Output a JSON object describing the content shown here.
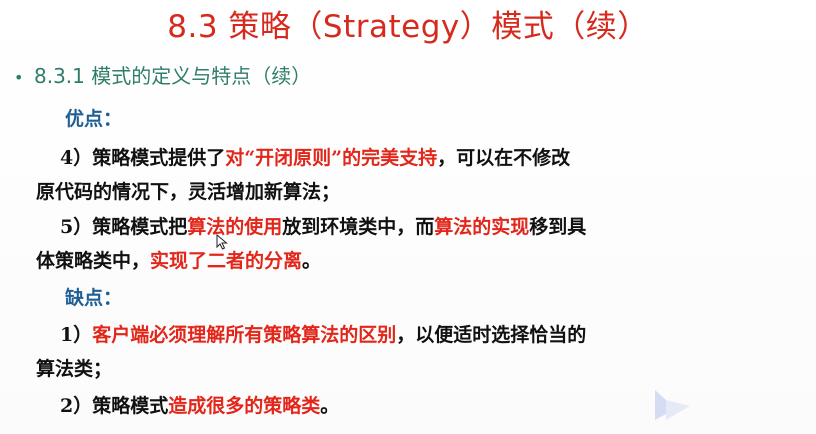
{
  "slide": {
    "title": "8.3 策略（Strategy）模式（续）",
    "section": {
      "bullet": "•",
      "text": "8.3.1 模式的定义与特点（续）"
    },
    "advantages": {
      "label": "优点：",
      "items": [
        {
          "line1": [
            {
              "text": "4）策略模式提供了",
              "emph": false
            },
            {
              "text": "对“开闭原则”的完美支持",
              "emph": true
            },
            {
              "text": "，可以在不修改",
              "emph": false
            }
          ],
          "line2": [
            {
              "text": "原代码的情况下，灵活增加新算法；",
              "emph": false
            }
          ]
        },
        {
          "line1": [
            {
              "text": "5）策略模式把",
              "emph": false
            },
            {
              "text": "算法的使用",
              "emph": true
            },
            {
              "text": "放到环境类中，而",
              "emph": false
            },
            {
              "text": "算法的实现",
              "emph": true
            },
            {
              "text": "移到具",
              "emph": false
            }
          ],
          "line2": [
            {
              "text": "体策略类中，",
              "emph": false
            },
            {
              "text": "实现了二者的分离",
              "emph": true
            },
            {
              "text": "。",
              "emph": false
            }
          ]
        }
      ]
    },
    "disadvantages": {
      "label": "缺点：",
      "items": [
        {
          "line1": [
            {
              "text": "1）",
              "emph": false
            },
            {
              "text": "客户端必须理解所有策略算法的区别",
              "emph": true
            },
            {
              "text": "，以便适时选择恰当的",
              "emph": false
            }
          ],
          "line2": [
            {
              "text": "算法类；",
              "emph": false
            }
          ]
        },
        {
          "line1": [
            {
              "text": "2）策略模式",
              "emph": false
            },
            {
              "text": "造成很多的策略类",
              "emph": true
            },
            {
              "text": "。",
              "emph": false
            }
          ]
        }
      ]
    },
    "colors": {
      "title": "#d62a1e",
      "section": "#2f7d6b",
      "label": "#1f5f96",
      "emphasis": "#e2261a",
      "body": "#111111"
    }
  }
}
